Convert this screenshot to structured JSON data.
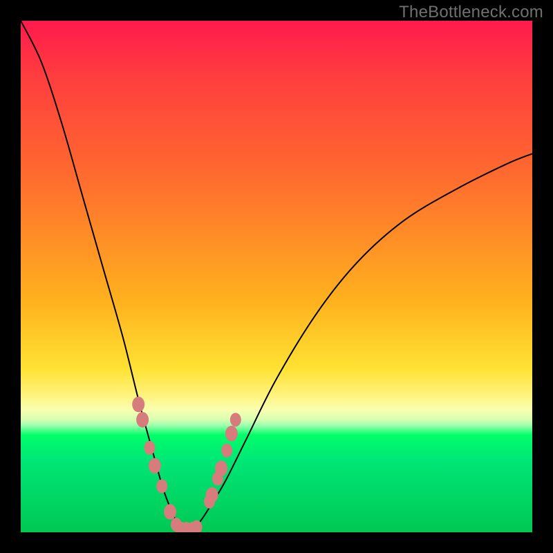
{
  "watermark": "TheBottleneck.com",
  "colors": {
    "frame": "#000000",
    "gradient_top": "#ff1a4d",
    "gradient_mid": "#ffe233",
    "gradient_bottom": "#00c853",
    "curve": "#000000",
    "dots": "#d67c7c"
  },
  "chart_data": {
    "type": "line",
    "title": "",
    "xlabel": "",
    "ylabel": "",
    "xlim": [
      0,
      100
    ],
    "ylim": [
      0,
      100
    ],
    "grid": false,
    "legend": false,
    "description": "Bottleneck-style V curve: value drops from ~100 at the left edge to ~0 near x≈32, then rises with a concave curve toward ~75 at the right edge. Background gradient encodes value (red high, green low).",
    "series": [
      {
        "name": "bottleneck-curve",
        "x": [
          0,
          4,
          8,
          12,
          16,
          20,
          23,
          26,
          28,
          30,
          31,
          32,
          33,
          34,
          35,
          37,
          40,
          44,
          50,
          58,
          66,
          75,
          85,
          95,
          100
        ],
        "y": [
          100,
          92,
          80,
          66,
          52,
          38,
          26,
          15,
          8,
          3,
          1,
          0,
          0,
          1,
          2,
          5,
          10,
          18,
          30,
          43,
          53,
          61,
          67,
          72,
          74
        ]
      }
    ],
    "dots": {
      "name": "highlighted-points",
      "x": [
        23.0,
        23.8,
        25.2,
        26.2,
        27.6,
        29.2,
        30.4,
        31.4,
        32.4,
        33.6,
        34.4,
        36.9,
        37.4,
        38.5,
        39.2,
        40.3,
        41.2,
        42.0
      ],
      "y": [
        25.0,
        22.0,
        16.5,
        13.0,
        9.0,
        4.0,
        1.5,
        0.5,
        0.5,
        0.5,
        1.0,
        6.0,
        7.3,
        10.5,
        12.5,
        16.0,
        19.3,
        22.0
      ],
      "r": [
        9,
        9,
        8,
        9,
        8,
        9,
        8,
        9,
        9,
        9,
        8,
        8,
        9,
        8,
        9,
        8,
        9,
        8
      ]
    }
  }
}
